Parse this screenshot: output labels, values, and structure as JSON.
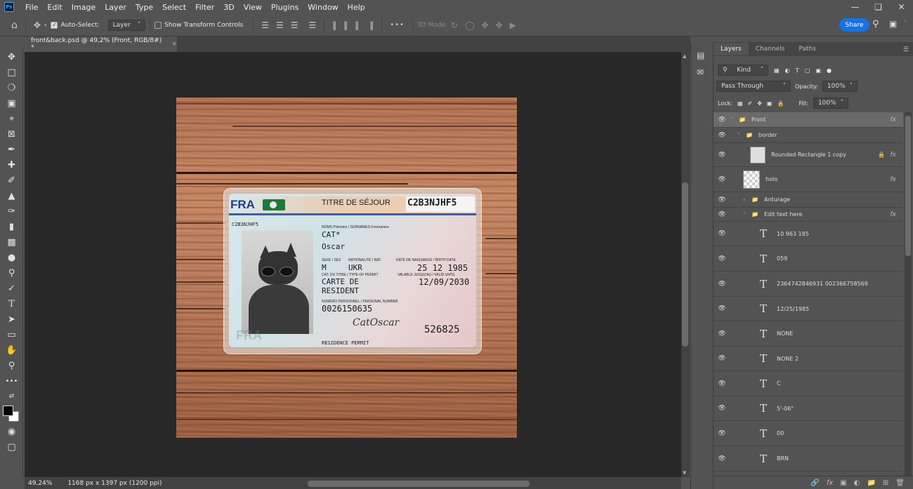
{
  "app": {
    "logo": "Ps"
  },
  "menu": [
    "File",
    "Edit",
    "Image",
    "Layer",
    "Type",
    "Select",
    "Filter",
    "3D",
    "View",
    "Plugins",
    "Window",
    "Help"
  ],
  "options": {
    "auto_select_label": "Auto-Select:",
    "auto_select_value": "Layer",
    "show_transform_label": "Show Transform Controls",
    "mode_3d_label": "3D Mode:",
    "more_label": "•••",
    "share_label": "Share"
  },
  "document": {
    "tab_title": "front&back.psd @ 49,2% (Front, RGB/8#) *",
    "close": "×"
  },
  "card": {
    "country_code": "FRA",
    "title": "TITRE DE SÉJOUR",
    "number_top": "C2B3NJHF5",
    "number_small": "C2B3NJHF5",
    "names_label": "NOMS Prénoms / SURNAMES Forenames",
    "surname": "CAT*",
    "forename": "Oscar",
    "sex_label": "SEXE / SEX",
    "nationality_label": "NATIONALITÉ / NAT.",
    "dob_label": "DATE DE NAISSANCE / BIRTH DATE",
    "sex": "M",
    "nationality": "UKR",
    "dob": "25 12 1985",
    "permit_type_label": "CAT. DU TITRE / TYPE OF PERMIT",
    "valid_label": "VALABLE JUSQU'AU / VALID UNTIL",
    "permit_type_1": "CARTE DE",
    "permit_type_2": "RESIDENT",
    "valid_until": "12/09/2030",
    "personal_label": "NUMÉRO PERSONNEL / PERSONAL NUMBER",
    "personal_number": "0026150635",
    "signature": "CatOscar",
    "code": "526825",
    "ghost": "FRA",
    "footer": "RESIDENCE PERMIT"
  },
  "status": {
    "zoom": "49,24%",
    "doc_info": "1168 px x 1397 px (1200 ppi)",
    "arrow": "›"
  },
  "layers_panel": {
    "tabs": [
      "Layers",
      "Channels",
      "Paths"
    ],
    "filter_kind": "Kind",
    "blend_mode": "Pass Through",
    "opacity_label": "Opacity:",
    "opacity_value": "100%",
    "lock_label": "Lock:",
    "fill_label": "Fill:",
    "fill_value": "100%",
    "layers": [
      {
        "name": "Front",
        "kind": "group",
        "fx": true
      },
      {
        "name": "border",
        "kind": "group",
        "fx": false
      },
      {
        "name": "Rounded Rectangle 1 copy",
        "kind": "shape",
        "fx": true
      },
      {
        "name": "holo",
        "kind": "pixel",
        "fx": true
      },
      {
        "name": "Anturage",
        "kind": "group",
        "fx": false
      },
      {
        "name": "Edit text here",
        "kind": "group",
        "fx": true
      },
      {
        "name": "10 963 185",
        "kind": "text"
      },
      {
        "name": "059",
        "kind": "text"
      },
      {
        "name": "2364742846931 002366758569",
        "kind": "text"
      },
      {
        "name": "12/25/1985",
        "kind": "text"
      },
      {
        "name": "NONE",
        "kind": "text"
      },
      {
        "name": "NONE 2",
        "kind": "text"
      },
      {
        "name": "C",
        "kind": "text"
      },
      {
        "name": "5'-06\"",
        "kind": "text"
      },
      {
        "name": "00",
        "kind": "text"
      },
      {
        "name": "BRN",
        "kind": "text"
      }
    ],
    "fx_label": "fx",
    "text_glyph": "T"
  },
  "colors": {
    "accent": "#1473e6",
    "panel": "#535353",
    "canvas": "#282828"
  }
}
